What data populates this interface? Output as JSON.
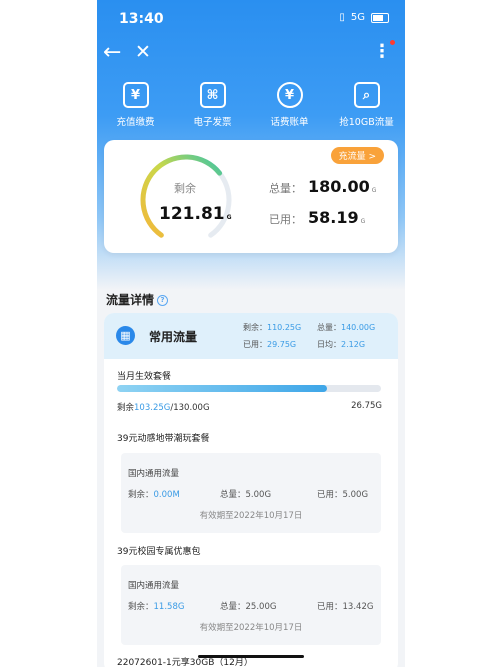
{
  "status": {
    "time": "13:40",
    "network": "5G"
  },
  "quick": [
    {
      "icon": "wallet-icon",
      "glyph": "¥",
      "label": "充值缴费"
    },
    {
      "icon": "ticket-icon",
      "glyph": "⌘",
      "label": "电子发票"
    },
    {
      "icon": "bill-icon",
      "glyph": "¥",
      "label": "话费账单"
    },
    {
      "icon": "doc-search-icon",
      "glyph": "⌕",
      "label": "抢10GB流量"
    }
  ],
  "summary": {
    "remain_label": "剩余",
    "remain_value": "121.81",
    "remain_fraction": 0.677,
    "unit": "G",
    "recharge_label": "充流量 >",
    "total_label": "总量：",
    "total_value": "180.00",
    "used_label": "已用：",
    "used_value": "58.19"
  },
  "section": {
    "title": "流量详情"
  },
  "detail": {
    "title": "常用流量",
    "remain_label": "剩余：",
    "remain_value": "110.25G",
    "total_label": "总量：",
    "total_value": "140.00G",
    "used_label": "已用：",
    "used_value": "29.75G",
    "daily_label": "日均：",
    "daily_value": "2.12G"
  },
  "current_plan": {
    "title": "当月生效套餐",
    "remain_label": "剩余",
    "remain_value": "103.25G",
    "total_value": "/130.00G",
    "used_value": "26.75G",
    "fraction": 0.794
  },
  "packages": [
    {
      "title": "39元动感地带潮玩套餐",
      "sub_title": "国内通用流量",
      "remain_label": "剩余：",
      "remain_value": "0.00M",
      "total_label": "总量：",
      "total_value": "5.00G",
      "used_label": "已用：",
      "used_value": "5.00G",
      "expiry": "有效期至2022年10月17日"
    },
    {
      "title": "39元校园专属优惠包",
      "sub_title": "国内通用流量",
      "remain_label": "剩余：",
      "remain_value": "11.58G",
      "total_label": "总量：",
      "total_value": "25.00G",
      "used_label": "已用：",
      "used_value": "13.42G",
      "expiry": "有效期至2022年10月17日"
    },
    {
      "title": "22072601-1元享30GB（12月）"
    }
  ]
}
